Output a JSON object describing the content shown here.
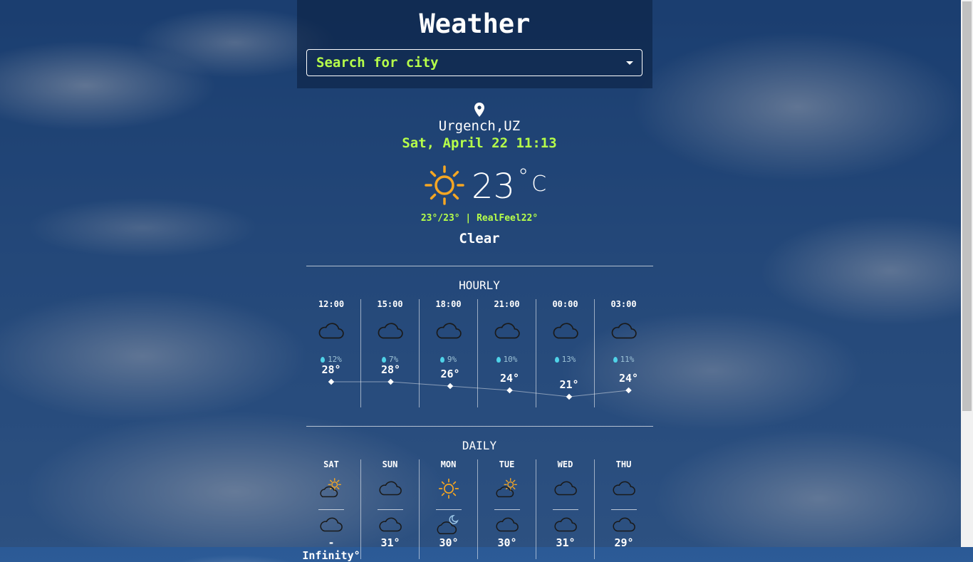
{
  "app": {
    "title": "Weather"
  },
  "search": {
    "placeholder": "Search for city"
  },
  "current": {
    "location": "Urgench,UZ",
    "datetime": "Sat, April 22 11:13",
    "temperature": "23",
    "degree": "°",
    "unit": "C",
    "minmax": "23°/23° | RealFeel22°",
    "condition": "Clear",
    "icon": "sun-icon"
  },
  "hourly": {
    "title": "HOURLY",
    "items": [
      {
        "time": "12:00",
        "icon": "cloud-icon",
        "rain": "12%",
        "temp": "28°",
        "value": 28
      },
      {
        "time": "15:00",
        "icon": "cloud-icon",
        "rain": "7%",
        "temp": "28°",
        "value": 28
      },
      {
        "time": "18:00",
        "icon": "cloud-icon",
        "rain": "9%",
        "temp": "26°",
        "value": 26
      },
      {
        "time": "21:00",
        "icon": "cloud-icon",
        "rain": "10%",
        "temp": "24°",
        "value": 24
      },
      {
        "time": "00:00",
        "icon": "cloud-icon",
        "rain": "13%",
        "temp": "21°",
        "value": 21
      },
      {
        "time": "03:00",
        "icon": "cloud-icon",
        "rain": "11%",
        "temp": "24°",
        "value": 24
      }
    ]
  },
  "daily": {
    "title": "DAILY",
    "items": [
      {
        "day": "SAT",
        "day_icon": "partly-sunny-icon",
        "night_icon": "cloud-icon",
        "temp": "-Infinity°"
      },
      {
        "day": "SUN",
        "day_icon": "cloud-icon",
        "night_icon": "cloud-icon",
        "temp": "31°"
      },
      {
        "day": "MON",
        "day_icon": "sun-icon",
        "night_icon": "cloudy-night-icon",
        "temp": "30°"
      },
      {
        "day": "TUE",
        "day_icon": "partly-sunny-icon",
        "night_icon": "cloud-icon",
        "temp": "30°"
      },
      {
        "day": "WED",
        "day_icon": "cloud-icon",
        "night_icon": "cloud-icon",
        "temp": "31°"
      },
      {
        "day": "THU",
        "day_icon": "cloud-icon",
        "night_icon": "cloud-icon",
        "temp": "29°"
      }
    ]
  },
  "colors": {
    "accent": "#b6ff4a",
    "sun": "#f5a623",
    "drop": "#4fd3e8"
  }
}
